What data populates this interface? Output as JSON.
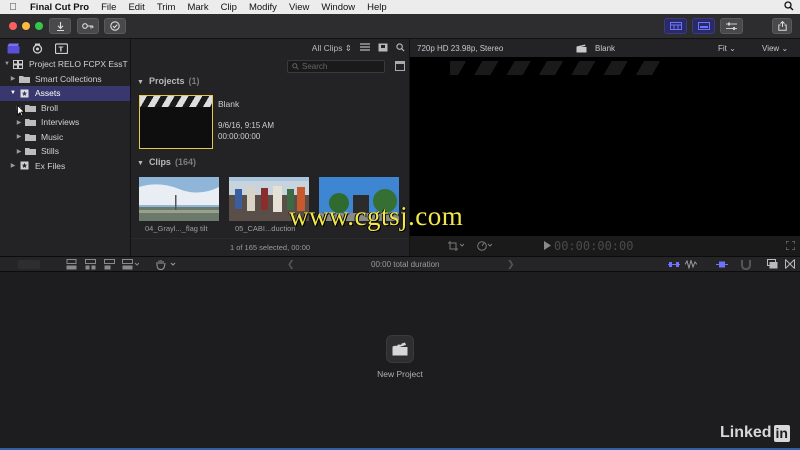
{
  "menubar": {
    "app_name": "Final Cut Pro",
    "items": [
      "File",
      "Edit",
      "Trim",
      "Mark",
      "Clip",
      "Modify",
      "View",
      "Window",
      "Help"
    ]
  },
  "library": {
    "rows": [
      {
        "label": "Project RELO FCPX EssT",
        "depth": 0,
        "expanded": true,
        "icon": "library-icon"
      },
      {
        "label": "Smart Collections",
        "depth": 1,
        "expanded": false,
        "icon": "folder-icon"
      },
      {
        "label": "Assets",
        "depth": 1,
        "expanded": true,
        "icon": "event-icon",
        "selected": true
      },
      {
        "label": "Broll",
        "depth": 2,
        "expanded": false,
        "icon": "folder-icon"
      },
      {
        "label": "Interviews",
        "depth": 2,
        "expanded": false,
        "icon": "folder-icon"
      },
      {
        "label": "Music",
        "depth": 2,
        "expanded": false,
        "icon": "folder-icon"
      },
      {
        "label": "Stills",
        "depth": 2,
        "expanded": false,
        "icon": "folder-icon"
      },
      {
        "label": "Ex Files",
        "depth": 1,
        "expanded": false,
        "icon": "event-icon"
      }
    ]
  },
  "browser": {
    "filter": "All Clips",
    "search_placeholder": "Search",
    "projects_label": "Projects",
    "projects_count": "(1)",
    "project": {
      "name": "Blank",
      "date": "9/6/16, 9:15 AM",
      "duration": "00:00:00:00"
    },
    "clips_label": "Clips",
    "clips_count": "(164)",
    "clips": [
      {
        "name": "04_Grayl..._flag tilt"
      },
      {
        "name": "05_CABI...duction"
      },
      {
        "name": ""
      }
    ],
    "status": "1 of 165 selected, 00:00"
  },
  "viewer": {
    "format": "720p HD 23.98p, Stereo",
    "clip_name": "Blank",
    "fit": "Fit",
    "view": "View",
    "timecode": "00:00:00:00"
  },
  "timeline": {
    "duration": "00:00 total duration",
    "new_project_label": "New Project"
  },
  "overlay": {
    "watermark": "www.cgtsj.com",
    "brand_linked": "Linked",
    "brand_in": "in"
  },
  "colors": {
    "selection": "#38386e",
    "project_border": "#e5c84a",
    "watermark": "#f2e74a",
    "accent": "#5a4fd9"
  }
}
